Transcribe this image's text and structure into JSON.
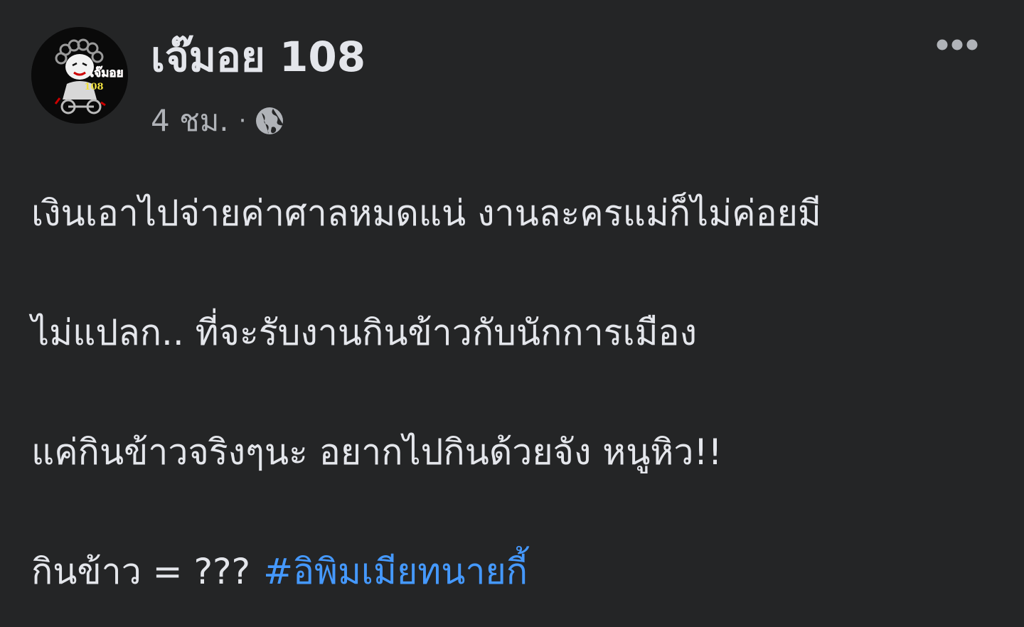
{
  "post": {
    "author": {
      "name": "เจ๊มอย 108",
      "avatar_icon": "profile-avatar-icon",
      "avatar_text": "เจ๊มอย",
      "avatar_number": "108"
    },
    "meta": {
      "time": "4 ชม.",
      "separator": "·",
      "privacy_icon": "globe-icon"
    },
    "more_icon": "more-horizontal-icon",
    "body": {
      "line1": "เงินเอาไปจ่ายค่าศาลหมดแน่ งานละครแม่ก็ไม่ค่อยมี",
      "line2": "ไม่แปลก.. ที่จะรับงานกินข้าวกับนักการเมือง",
      "line3": "แค่กินข้าวจริงๆนะ อยากไปกินด้วยจัง หนูหิว!!",
      "line4_text": "กินข้าว = ???",
      "hashtag": "#อิพิมเมียทนายกี้"
    }
  },
  "colors": {
    "background": "#242526",
    "primary_text": "#e4e6eb",
    "secondary_text": "#b0b3b8",
    "hashtag": "#4599ff"
  }
}
